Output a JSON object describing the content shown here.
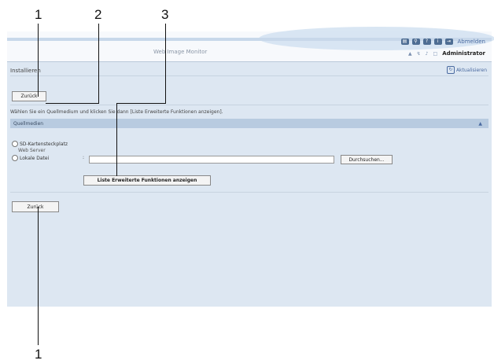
{
  "callouts": {
    "top": [
      "1",
      "2",
      "3"
    ],
    "bottom": "1"
  },
  "header": {
    "app_title": "Web Image Monitor",
    "logout": "Abmelden",
    "user": "Administrator",
    "icons": [
      "printer-icon",
      "search-icon",
      "help-icon",
      "info-icon",
      "logout-icon"
    ],
    "sub_icons": [
      "▲",
      "↯",
      "♪",
      "□"
    ]
  },
  "page": {
    "title": "Installieren",
    "refresh": "Aktualisieren",
    "back_top": "Zurück",
    "back_bottom": "Zurück",
    "instruction": "Wählen Sie ein Quellmedium und klicken Sie dann [Liste Erweiterte Funktionen anzeigen].",
    "section": {
      "title": "Quellmedien",
      "radios": [
        {
          "label": "SD-Kartensteckplatz",
          "selected": false
        },
        {
          "label": "Web Server",
          "selected": false,
          "disabled": true
        },
        {
          "label": "Lokale Datei",
          "selected": false
        }
      ],
      "file_value": "",
      "browse": "Durchsuchen...",
      "list_button": "Liste Erweiterte Funktionen anzeigen"
    }
  },
  "colors": {
    "frame": "#dde7f2",
    "section": "#b8cbe0",
    "accent": "#4a6aa0"
  }
}
